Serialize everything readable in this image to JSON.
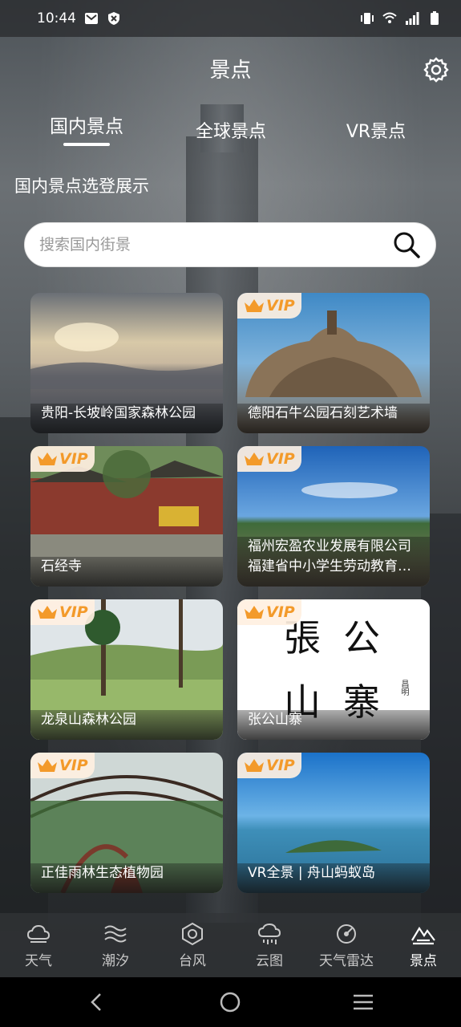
{
  "status": {
    "time": "10:44"
  },
  "header": {
    "title": "景点"
  },
  "tabs": [
    {
      "label": "国内景点",
      "active": true
    },
    {
      "label": "全球景点",
      "active": false
    },
    {
      "label": "VR景点",
      "active": false
    }
  ],
  "section_title": "国内景点选登展示",
  "search": {
    "placeholder": "搜索国内街景",
    "value": ""
  },
  "vip_label": "VIP",
  "cards": [
    {
      "lines": [
        "贵阳-长坡岭国家森林公园"
      ],
      "vip": false
    },
    {
      "lines": [
        "德阳石牛公园石刻艺术墙"
      ],
      "vip": true
    },
    {
      "lines": [
        "石经寺"
      ],
      "vip": true
    },
    {
      "lines": [
        "福州宏盈农业发展有限公司",
        "福建省中小学生劳动教育…"
      ],
      "vip": true
    },
    {
      "lines": [
        "龙泉山森林公园"
      ],
      "vip": true
    },
    {
      "lines": [
        "张公山寨"
      ],
      "vip": true,
      "image_text": [
        "張",
        "公",
        "山",
        "寨",
        "昌明"
      ]
    },
    {
      "lines": [
        "正佳雨林生态植物园"
      ],
      "vip": true
    },
    {
      "lines": [
        "VR全景 | 舟山蚂蚁岛"
      ],
      "vip": true
    }
  ],
  "bottom_nav": [
    {
      "label": "天气",
      "icon": "weather-icon",
      "active": false
    },
    {
      "label": "潮汐",
      "icon": "tide-icon",
      "active": false
    },
    {
      "label": "台风",
      "icon": "typhoon-icon",
      "active": false
    },
    {
      "label": "云图",
      "icon": "cloud-map-icon",
      "active": false
    },
    {
      "label": "天气雷达",
      "icon": "radar-icon",
      "active": false
    },
    {
      "label": "景点",
      "icon": "mountain-icon",
      "active": true
    }
  ],
  "colors": {
    "vip_accent": "#f39a2a",
    "text": "#ffffff"
  }
}
